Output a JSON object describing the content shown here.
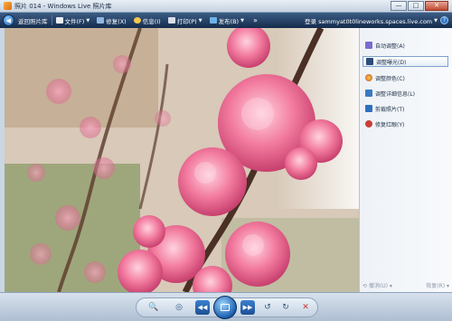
{
  "window": {
    "title": "照片 014 - Windows Live 照片库",
    "minimize": "—",
    "maximize": "□",
    "close": "✕"
  },
  "toolbar": {
    "back_label": "返回照片库",
    "file_label": "文件(F)",
    "fix_label": "修复(X)",
    "info_label": "信息(I)",
    "print_label": "打印(P)",
    "publish_label": "发布(B)",
    "more_label": "»",
    "account_label": "登录 sammyat0t0lineworks.spaces.live.com",
    "help_label": "?"
  },
  "pane": {
    "items": [
      {
        "label": "自动调整(A)",
        "icon": "wand-icon",
        "color": "#7a6bd0"
      },
      {
        "label": "调整曝光(D)",
        "icon": "exposure-icon",
        "color": "#2c4d7a"
      },
      {
        "label": "调整颜色(C)",
        "icon": "color-icon",
        "color": "#e27a2f"
      },
      {
        "label": "调整详细信息(L)",
        "icon": "detail-icon",
        "color": "#3a7ac2"
      },
      {
        "label": "剪裁照片(T)",
        "icon": "crop-icon",
        "color": "#2f6fbf"
      },
      {
        "label": "修复红眼(Y)",
        "icon": "redeye-icon",
        "color": "#c84035"
      }
    ],
    "undo_label": "撤消(U)",
    "redo_label": "恢复(R)"
  },
  "colors": {
    "toolbar_bg": "#1f3b61",
    "blossom": "#f27a9e",
    "accent": "#1a5fb0"
  }
}
